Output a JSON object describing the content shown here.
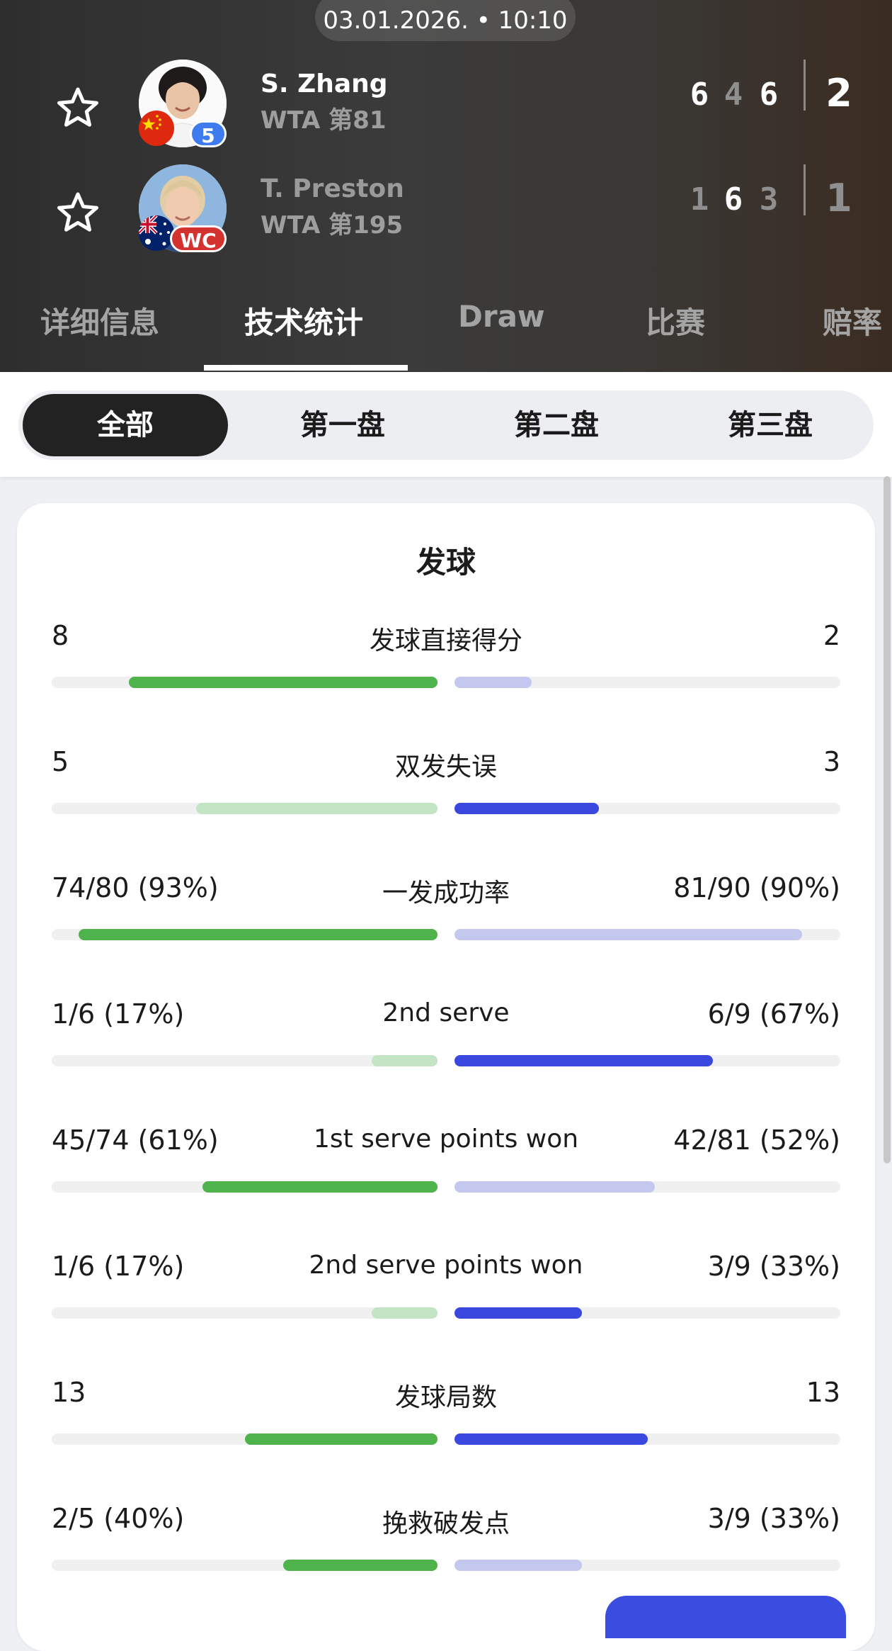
{
  "match": {
    "datetime": "03.01.2026. • 10:10"
  },
  "players": [
    {
      "name": "S. Zhang",
      "rank": "WTA 第81",
      "seed": "5",
      "sets": [
        "6",
        "4",
        "6"
      ],
      "set_wins": [
        true,
        false,
        true
      ],
      "total": "2",
      "winner": true
    },
    {
      "name": "T. Preston",
      "rank": "WTA 第195",
      "seed": "WC",
      "sets": [
        "1",
        "6",
        "3"
      ],
      "set_wins": [
        false,
        true,
        false
      ],
      "total": "1",
      "winner": false
    }
  ],
  "tabs": [
    "详细信息",
    "技术统计",
    "Draw",
    "比赛",
    "赔率"
  ],
  "active_tab": 1,
  "set_filter": [
    "全部",
    "第一盘",
    "第二盘",
    "第三盘"
  ],
  "active_set_filter": 0,
  "section_title": "发球",
  "colors": {
    "green_strong": "#4db34a",
    "green_light": "#c3e4c5",
    "blue_strong": "#3b48e0",
    "blue_light": "#c5c8ee",
    "track": "#f0f0f0",
    "seed_blue": "#3d7bef",
    "seed_red": "#d3322f"
  },
  "stats": [
    {
      "label": "发球直接得分",
      "left": "8",
      "right": "2",
      "left_frac": 0.8,
      "right_frac": 0.2,
      "leader": "left"
    },
    {
      "label": "双发失误",
      "left": "5",
      "right": "3",
      "left_frac": 0.625,
      "right_frac": 0.375,
      "leader": "right"
    },
    {
      "label": "一发成功率",
      "left": "74/80 (93%)",
      "right": "81/90 (90%)",
      "left_frac": 0.93,
      "right_frac": 0.9,
      "leader": "left"
    },
    {
      "label": "2nd serve",
      "left": "1/6 (17%)",
      "right": "6/9 (67%)",
      "left_frac": 0.17,
      "right_frac": 0.67,
      "leader": "right"
    },
    {
      "label": "1st serve points won",
      "left": "45/74 (61%)",
      "right": "42/81 (52%)",
      "left_frac": 0.61,
      "right_frac": 0.52,
      "leader": "left"
    },
    {
      "label": "2nd serve points won",
      "left": "1/6 (17%)",
      "right": "3/9 (33%)",
      "left_frac": 0.17,
      "right_frac": 0.33,
      "leader": "right"
    },
    {
      "label": "发球局数",
      "left": "13",
      "right": "13",
      "left_frac": 0.5,
      "right_frac": 0.5,
      "leader": "both"
    },
    {
      "label": "挽救破发点",
      "left": "2/5 (40%)",
      "right": "3/9 (33%)",
      "left_frac": 0.4,
      "right_frac": 0.33,
      "leader": "left"
    }
  ]
}
